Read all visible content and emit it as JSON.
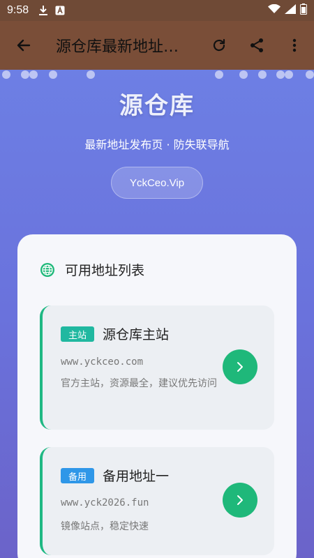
{
  "status_bar": {
    "time": "9:58"
  },
  "toolbar": {
    "title": "源仓库最新地址发布页"
  },
  "hero": {
    "title": "源仓库",
    "subtitle": "最新地址发布页 · 防失联导航",
    "domain": "YckCeo.Vip"
  },
  "list": {
    "heading": "可用地址列表",
    "items": [
      {
        "badge": "主站",
        "title": "源仓库主站",
        "url": "www.yckceo.com",
        "desc": "官方主站，资源最全，建议优先访问",
        "badge_color": "#20b8a0"
      },
      {
        "badge": "备用",
        "title": "备用地址一",
        "url": "www.yck2026.fun",
        "desc": "镜像站点，稳定快速",
        "badge_color": "#2f97e8"
      }
    ]
  },
  "colors": {
    "accent": "#1fb87a",
    "toolbar": "#7a4e38",
    "hero": "#6a75df"
  }
}
